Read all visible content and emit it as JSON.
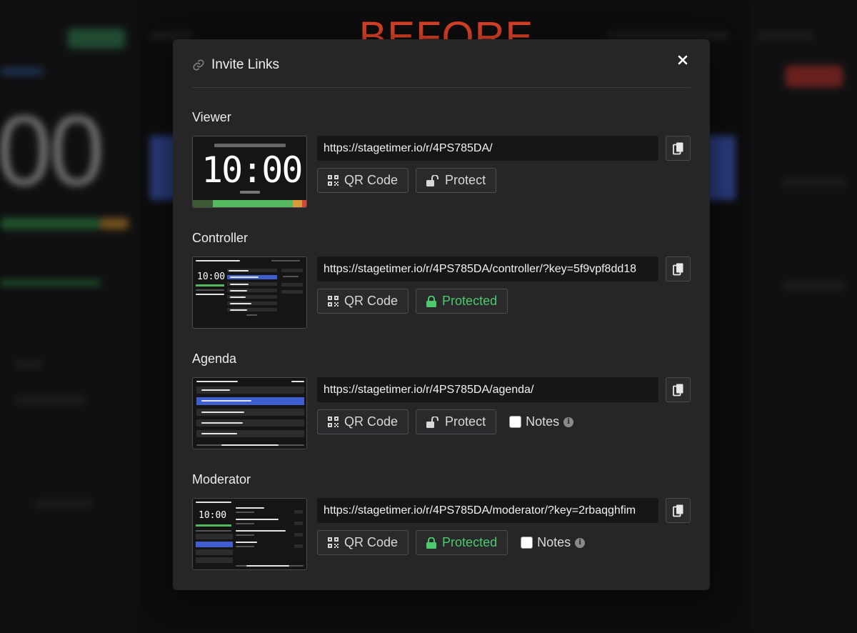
{
  "overlay_label": "BEFORE",
  "modal": {
    "title": "Invite Links",
    "icons": {
      "header": "link-icon",
      "close": "close-icon",
      "copy": "copy-icon",
      "qr": "qr-code-icon",
      "unlock": "unlock-icon",
      "lock": "lock-icon",
      "info": "info-icon"
    },
    "colors": {
      "protected": "#4cc96a",
      "accent_blue": "#3f5fd0",
      "before_label": "#d64027"
    }
  },
  "sections": [
    {
      "title": "Viewer",
      "url": "https://stagetimer.io/r/4PS785DA/",
      "qr_label": "QR Code",
      "protect_label": "Protect",
      "protected": false,
      "thumb_time": "10:00"
    },
    {
      "title": "Controller",
      "url": "https://stagetimer.io/r/4PS785DA/controller/?key=5f9vpf8dd18",
      "qr_label": "QR Code",
      "protect_label": "Protected",
      "protected": true,
      "thumb_time": "10:00"
    },
    {
      "title": "Agenda",
      "url": "https://stagetimer.io/r/4PS785DA/agenda/",
      "qr_label": "QR Code",
      "protect_label": "Protect",
      "protected": false,
      "notes_label": "Notes",
      "notes_checked": false
    },
    {
      "title": "Moderator",
      "url": "https://stagetimer.io/r/4PS785DA/moderator/?key=2rbaqghfim",
      "qr_label": "QR Code",
      "protect_label": "Protected",
      "protected": true,
      "notes_label": "Notes",
      "notes_checked": false,
      "thumb_time": "10:00"
    }
  ]
}
